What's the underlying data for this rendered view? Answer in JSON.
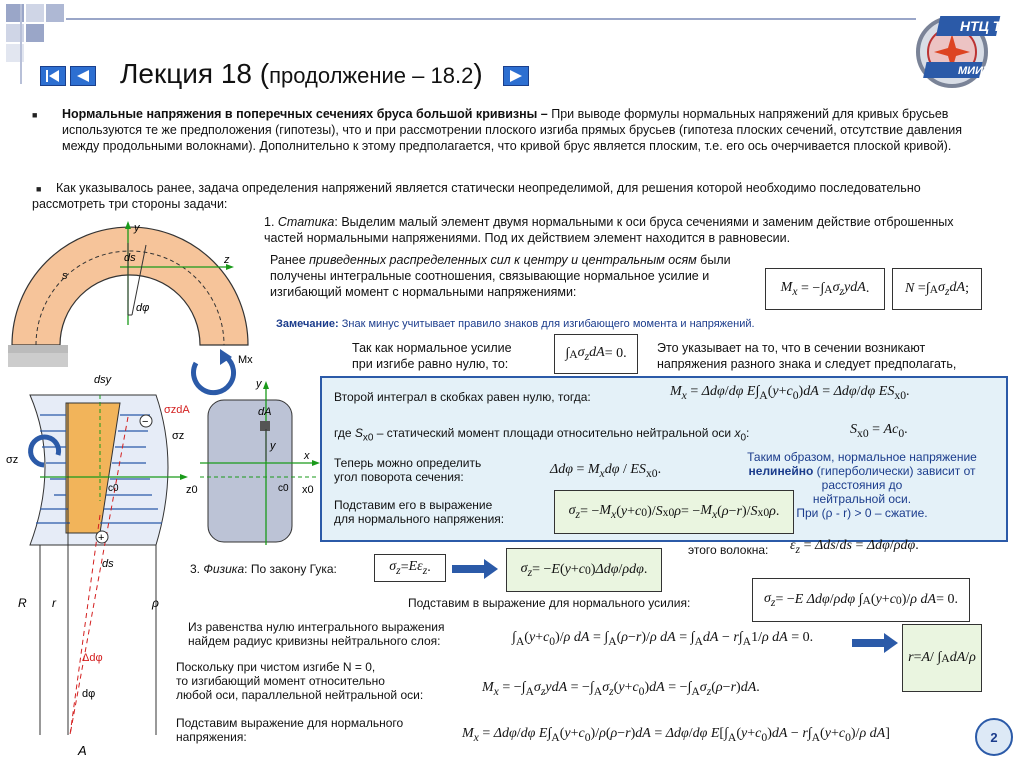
{
  "header": {
    "title_main": "Лекция 18 (",
    "title_sub": "продолжение – 18.2",
    "title_close": ")",
    "logo_top": "НТЦ ТТ",
    "logo_bottom": "МИИТ"
  },
  "intro": {
    "p1_bold": "Нормальные напряжения в поперечных сечениях бруса большой кривизны –",
    "p1_rest": " При выводе формулы нормальных напряжений для кривых брусьев используются те же предположения (гипотезы), что и при рассмотрении плоского изгиба прямых брусьев (гипотеза плоских сечений, отсутствие давления между продольными волокнами). Дополнительно к этому предполагается, что кривой брус является плоским, т.е. его ось очерчивается плоской кривой).",
    "p2": "Как указывалось ранее, задача определения напряжений является статически неопределимой, для решения которой необходимо последовательно рассмотреть три стороны задачи:"
  },
  "statics": {
    "line1_num": "1. ",
    "line1_em": "Статика",
    "line1_rest": ": Выделим малый элемент двумя нормальными к оси бруса сечениями и заменим действие отброшенных частей нормальными напряжениями. Под их действием элемент находится в равновесии.",
    "line2_a": "Ранее ",
    "line2_em": "приведенных распределенных сил к центру и центральным осям",
    "line2_b": " были получены интегральные соотношения, связывающие нормальное усилие и изгибающий момент с нормальными напряжениями:",
    "remark_bold": "Замечание:",
    "remark_rest": " Знак минус учитывает правило знаков для изгибающего момента и напряжений.",
    "n_zero_a": "Так как нормальное усилие",
    "n_zero_b": "при изгибе равно нулю, то:",
    "indicates_a": "Это указывает на то, что в сечении возникают",
    "indicates_b": "напряжения разного знака и следует предполагать,"
  },
  "overlay": {
    "second_integral": "Второй интеграл в скобках равен  нулю, тогда:",
    "sx0_a": "где ",
    "sx0_b": " – статический момент площади относительно нейтральной оси ",
    "angle_a": "Теперь можно определить",
    "angle_b": "угол поворота сечения:",
    "substitute_a": "Подставим его в выражение",
    "substitute_b": "для нормального напряжения:",
    "conclusion_a": "Таким образом, нормальное напряжение",
    "conclusion_bold": "нелинейно",
    "conclusion_b": " (гиперболически) зависит от",
    "conclusion_c": "расстояния до",
    "conclusion_d": "нейтральной оси.",
    "conclusion_e": "При (ρ - r) > 0 – сжатие."
  },
  "fiber_text": "этого волокна:",
  "physics": {
    "label_num": "3. ",
    "label_em": "Физика",
    "label_rest": ": По закону Гука:"
  },
  "lower": {
    "subst_force": "Подставим в выражение для нормального усилия:",
    "zero_integral_a": "Из равенства нулю интегрального выражения",
    "zero_integral_b": "найдем радиус кривизны нейтрального слоя:",
    "pure_bending_a": "Поскольку при чистом изгибе N = 0,",
    "pure_bending_b": "то изгибающий момент относительно",
    "pure_bending_c": "любой оси, параллельной нейтральной оси:",
    "subst_stress_a": "Подставим выражение для нормального",
    "subst_stress_b": "напряжения:"
  },
  "page_number": "2",
  "diagram_labels": {
    "y": "y",
    "z": "z",
    "ds": "ds",
    "s": "s",
    "dphi": "dφ",
    "Mx": "Mx",
    "dsy": "dsy",
    "sigma_dA": "σzdA",
    "sigma_z": "σz",
    "c0": "c0",
    "z0": "z0",
    "plus": "+",
    "minus": "−",
    "R": "R",
    "r": "r",
    "rho": "ρ",
    "A": "A",
    "ddphi": "Δdφ",
    "dA": "dA",
    "x": "x",
    "x0": "x0"
  },
  "colors": {
    "accent_blue": "#2b5aa8",
    "nav_blue": "#2d6fd1",
    "beam_fill": "#f6c49a",
    "element_fill": "#f2b45a",
    "overlay_bg": "#e4f1f8",
    "green_arrow": "#1a9a1a",
    "red_dash": "#d31f1f"
  }
}
